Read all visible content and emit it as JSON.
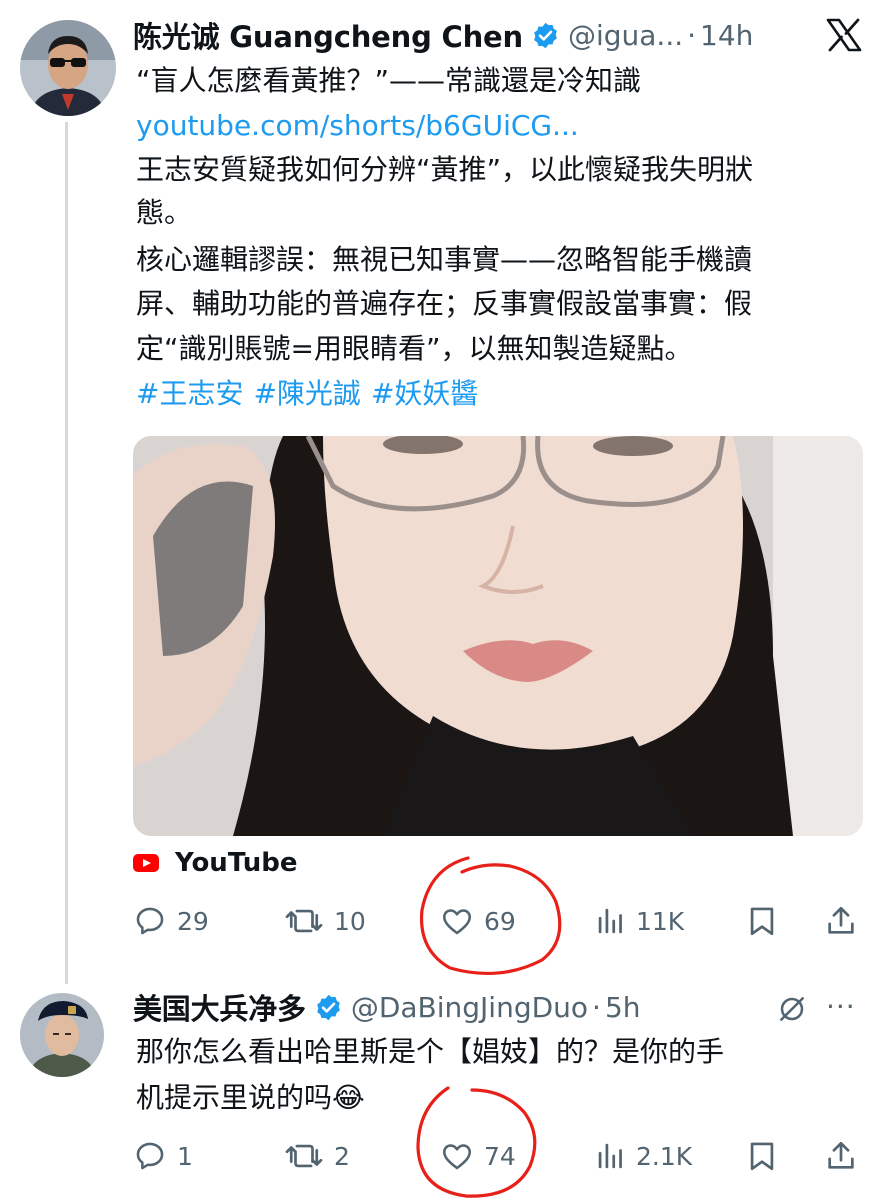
{
  "tweet1": {
    "display_name": "陈光诚 Guangcheng Chen",
    "handle": "@igua...",
    "separator": "·",
    "time": "14h",
    "text_line1": "“盲人怎麼看黃推？”——常識還是冷知識",
    "link": "youtube.com/shorts/b6GUiCG...",
    "text_line3": "王志安質疑我如何分辨“黃推”，以此懷疑我失明狀",
    "text_line4": "態。",
    "text_line5": "核心邏輯謬誤：無視已知事實——忽略智能手機讀",
    "text_line6": "屏、輔助功能的普遍存在；反事實假設當事實：假",
    "text_line7": "定“識別賬號=用眼睛看”，以無知製造疑點。",
    "hashtags": [
      "#王志安",
      "#陳光誠",
      "#妖妖醬"
    ],
    "link_card_source": "YouTube",
    "replies": "29",
    "retweets": "10",
    "likes": "69",
    "views": "11K"
  },
  "tweet2": {
    "display_name": "美国大兵净多",
    "handle": "@DaBingJingDuo",
    "separator": "·",
    "time": "5h",
    "text_line1": "那你怎么看出哈里斯是个【娼妓】的？是你的手",
    "text_line2": "机提示里说的吗😂",
    "replies": "1",
    "retweets": "2",
    "likes": "74",
    "views": "2.1K"
  },
  "colors": {
    "text": "#0f1419",
    "secondary": "#536471",
    "link": "#1d9bf0",
    "verified": "#1d9bf0",
    "youtube": "#ff0000",
    "annotation": "#e8201a"
  }
}
